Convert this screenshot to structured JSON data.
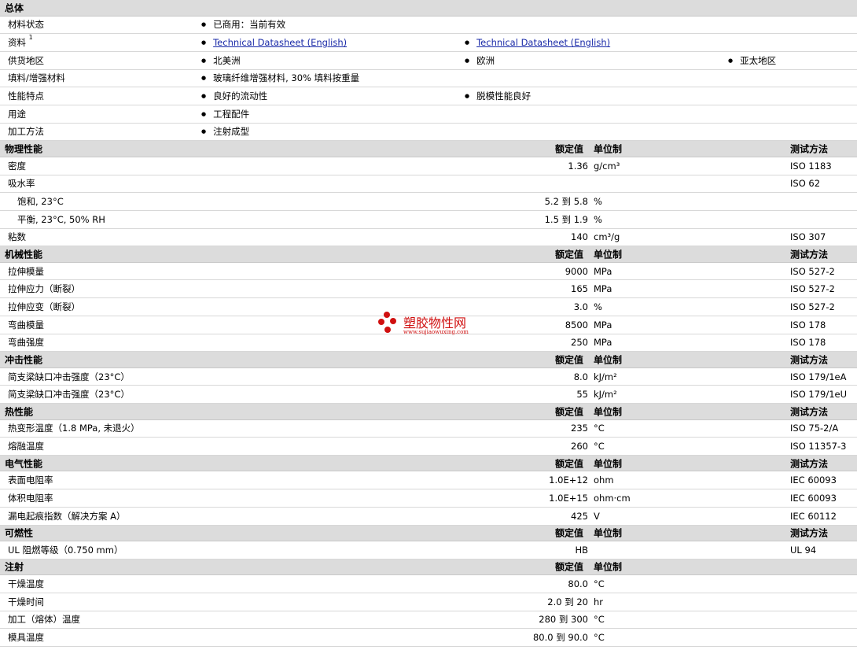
{
  "general": {
    "title": "总体",
    "status_label": "材料状态",
    "status_value": "已商用：当前有效",
    "resources_label": "资料",
    "resources_sup": "1",
    "datasheet_1": "Technical Datasheet (English)",
    "datasheet_2": "Technical Datasheet (English)",
    "region_label": "供货地区",
    "region_1": "北美洲",
    "region_2": "欧洲",
    "region_3": "亚太地区",
    "filler_label": "填料/增强材料",
    "filler_value": "玻璃纤维增强材料, 30% 填料按重量",
    "features_label": "性能特点",
    "feature_1": "良好的流动性",
    "feature_2": "脱模性能良好",
    "uses_label": "用途",
    "uses_value": "工程配件",
    "processing_label": "加工方法",
    "processing_value": "注射成型"
  },
  "col_headers": {
    "value": "额定值",
    "unit": "单位制",
    "method": "测试方法"
  },
  "physical": {
    "title": "物理性能",
    "rows": [
      {
        "label": "密度",
        "value": "1.36",
        "unit": "g/cm³",
        "method": "ISO 1183"
      },
      {
        "label": "吸水率",
        "value": "",
        "unit": "",
        "method": "ISO 62"
      },
      {
        "label": "饱和, 23°C",
        "value": "5.2 到  5.8",
        "unit": "%",
        "method": ""
      },
      {
        "label": "平衡, 23°C, 50% RH",
        "value": "1.5 到  1.9",
        "unit": "%",
        "method": ""
      },
      {
        "label": "粘数",
        "value": "140",
        "unit": "cm³/g",
        "method": "ISO 307"
      }
    ]
  },
  "mechanical": {
    "title": "机械性能",
    "rows": [
      {
        "label": "拉伸模量",
        "value": "9000",
        "unit": "MPa",
        "method": "ISO 527-2"
      },
      {
        "label": "拉伸应力（断裂）",
        "value": "165",
        "unit": "MPa",
        "method": "ISO 527-2"
      },
      {
        "label": "拉伸应变（断裂）",
        "value": "3.0",
        "unit": "%",
        "method": "ISO 527-2"
      },
      {
        "label": "弯曲模量",
        "value": "8500",
        "unit": "MPa",
        "method": "ISO 178"
      },
      {
        "label": "弯曲强度",
        "value": "250",
        "unit": "MPa",
        "method": "ISO 178"
      }
    ]
  },
  "impact": {
    "title": "冲击性能",
    "rows": [
      {
        "label": "简支梁缺口冲击强度（23°C）",
        "value": "8.0",
        "unit": "kJ/m²",
        "method": "ISO 179/1eA"
      },
      {
        "label": "简支梁缺口冲击强度（23°C）",
        "value": "55",
        "unit": "kJ/m²",
        "method": "ISO 179/1eU"
      }
    ]
  },
  "thermal": {
    "title": "热性能",
    "rows": [
      {
        "label": "热变形温度（1.8 MPa, 未退火）",
        "value": "235",
        "unit": "°C",
        "method": "ISO 75-2/A"
      },
      {
        "label": "熔融温度",
        "value": "260",
        "unit": "°C",
        "method": "ISO 11357-3"
      }
    ]
  },
  "electrical": {
    "title": "电气性能",
    "rows": [
      {
        "label": "表面电阻率",
        "value": "1.0E+12",
        "unit": "ohm",
        "method": "IEC 60093"
      },
      {
        "label": "体积电阻率",
        "value": "1.0E+15",
        "unit": "ohm·cm",
        "method": "IEC 60093"
      },
      {
        "label": "漏电起痕指数（解决方案 A）",
        "value": "425",
        "unit": "V",
        "method": "IEC 60112"
      }
    ]
  },
  "flammability": {
    "title": "可燃性",
    "rows": [
      {
        "label": "UL 阻燃等级（0.750 mm）",
        "value": "HB",
        "unit": "",
        "method": "UL 94"
      }
    ]
  },
  "injection": {
    "title": "注射",
    "rows": [
      {
        "label": "干燥温度",
        "value": "80.0",
        "unit": "°C",
        "method": ""
      },
      {
        "label": "干燥时间",
        "value": "2.0 到  20",
        "unit": "hr",
        "method": ""
      },
      {
        "label": "加工（熔体）温度",
        "value": "280 到  300",
        "unit": "°C",
        "method": ""
      },
      {
        "label": "模具温度",
        "value": "80.0 到  90.0",
        "unit": "°C",
        "method": ""
      }
    ]
  },
  "watermark": {
    "text": "塑胶物性网",
    "url": "www.sujiaowuxing.com",
    "color": "#d01010"
  }
}
